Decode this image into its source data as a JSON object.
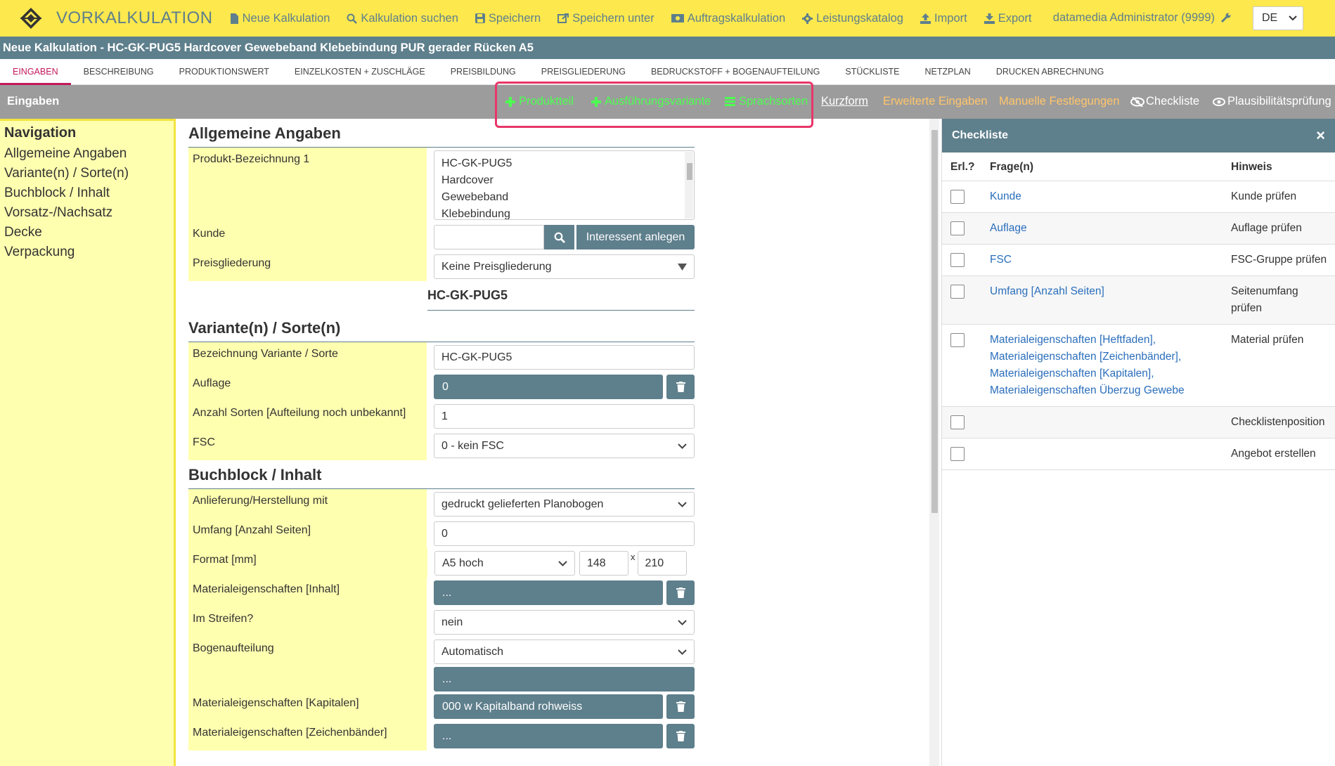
{
  "app": {
    "title": "VORKALKULATION",
    "nav": [
      {
        "label": "Neue Kalkulation",
        "icon": "document-icon"
      },
      {
        "label": "Kalkulation suchen",
        "icon": "search-icon"
      },
      {
        "label": "Speichern",
        "icon": "save-icon"
      },
      {
        "label": "Speichern unter",
        "icon": "save-as-icon"
      },
      {
        "label": "Auftragskalkulation",
        "icon": "money-icon"
      },
      {
        "label": "Leistungskatalog",
        "icon": "gear-icon"
      },
      {
        "label": "Import",
        "icon": "upload-icon"
      },
      {
        "label": "Export",
        "icon": "download-icon"
      }
    ],
    "user": "datamedia Administrator (9999)",
    "language": "DE"
  },
  "titlebar": "Neue Kalkulation - HC-GK-PUG5 Hardcover Gewebeband Klebebindung PUR gerader Rücken A5",
  "tabs": [
    "EINGABEN",
    "BESCHREIBUNG",
    "PRODUKTIONSWERT",
    "EINZELKOSTEN + ZUSCHLÄGE",
    "PREISBILDUNG",
    "PREISGLIEDERUNG",
    "BEDRUCKSTOFF + BOGENAUFTEILUNG",
    "STÜCKLISTE",
    "NETZPLAN",
    "DRUCKEN ABRECHNUNG"
  ],
  "toolbar": {
    "title": "Eingaben",
    "produktteil": "Produktteil",
    "ausfuehrung": "Ausführungsvariante",
    "sprachsorten": "Sprachsorten",
    "kurzform": "Kurzform",
    "erweitert": "Erweiterte Eingaben",
    "manuell": "Manuelle Festlegungen",
    "checkliste": "Checkliste",
    "plausi": "Plausibilitätsprüfung"
  },
  "leftnav": {
    "heading": "Navigation",
    "items": [
      "Allgemeine Angaben",
      "Variante(n) / Sorte(n)",
      "Buchblock / Inhalt",
      "Vorsatz-/Nachsatz",
      "Decke",
      "Verpackung"
    ]
  },
  "form": {
    "s1": "Allgemeine Angaben",
    "produkt_label": "Produkt-Bezeichnung 1",
    "produkt_lines": [
      "HC-GK-PUG5",
      "Hardcover",
      "Gewebeband",
      "Klebebindung"
    ],
    "kunde_label": "Kunde",
    "kunde_value": "",
    "interessent": "Interessent anlegen",
    "preisgl_label": "Preisgliederung",
    "preisgl_value": "Keine Preisgliederung",
    "code": "HC-GK-PUG5",
    "s2": "Variante(n) / Sorte(n)",
    "bez_label": "Bezeichnung Variante / Sorte",
    "bez_value": "HC-GK-PUG5",
    "auflage_label": "Auflage",
    "auflage_value": "0",
    "anzahl_label": "Anzahl Sorten [Aufteilung noch unbekannt]",
    "anzahl_value": "1",
    "fsc_label": "FSC",
    "fsc_value": "0 - kein FSC",
    "s3": "Buchblock / Inhalt",
    "anlief_label": "Anlieferung/Herstellung mit",
    "anlief_value": "gedruckt gelieferten Planobogen",
    "umfang_label": "Umfang [Anzahl Seiten]",
    "umfang_value": "0",
    "format_label": "Format [mm]",
    "format_value": "A5 hoch",
    "format_w": "148",
    "format_x": "x",
    "format_h": "210",
    "mat_inhalt_label": "Materialeigenschaften [Inhalt]",
    "mat_inhalt_value": "...",
    "streifen_label": "Im Streifen?",
    "streifen_value": "nein",
    "bogen_label": "Bogenaufteilung",
    "bogen_value": "Automatisch",
    "bogen_extra": "...",
    "kapitalen_label": "Materialeigenschaften [Kapitalen]",
    "kapitalen_value": "000 w Kapitalband rohweiss",
    "zeichen_label": "Materialeigenschaften [Zeichenbänder]",
    "zeichen_value": "..."
  },
  "checklist": {
    "title": "Checkliste",
    "close": "×",
    "headers": [
      "Erl.?",
      "Frage(n)",
      "Hinweis"
    ],
    "rows": [
      {
        "frage": "Kunde",
        "hinweis": "Kunde prüfen"
      },
      {
        "frage": "Auflage",
        "hinweis": "Auflage prüfen"
      },
      {
        "frage": "FSC",
        "hinweis": "FSC-Gruppe prüfen"
      },
      {
        "frage": "Umfang [Anzahl Seiten]",
        "hinweis": "Seitenumfang prüfen"
      },
      {
        "frage": "Materialeigenschaften [Heftfaden], Materialeigenschaften [Zeichenbänder], Materialeigenschaften [Kapitalen], Materialeigenschaften Überzug Gewebe",
        "hinweis": "Material prüfen"
      },
      {
        "frage": "",
        "hinweis": "Checklistenposition"
      },
      {
        "frage": "",
        "hinweis": "Angebot erstellen"
      }
    ]
  },
  "colors": {
    "yellow": "#fde84d",
    "slate": "#5e7f8c",
    "pink": "#c2185b",
    "green": "#4cff50",
    "orange": "#ffc56b",
    "link": "#2a6ebb"
  }
}
